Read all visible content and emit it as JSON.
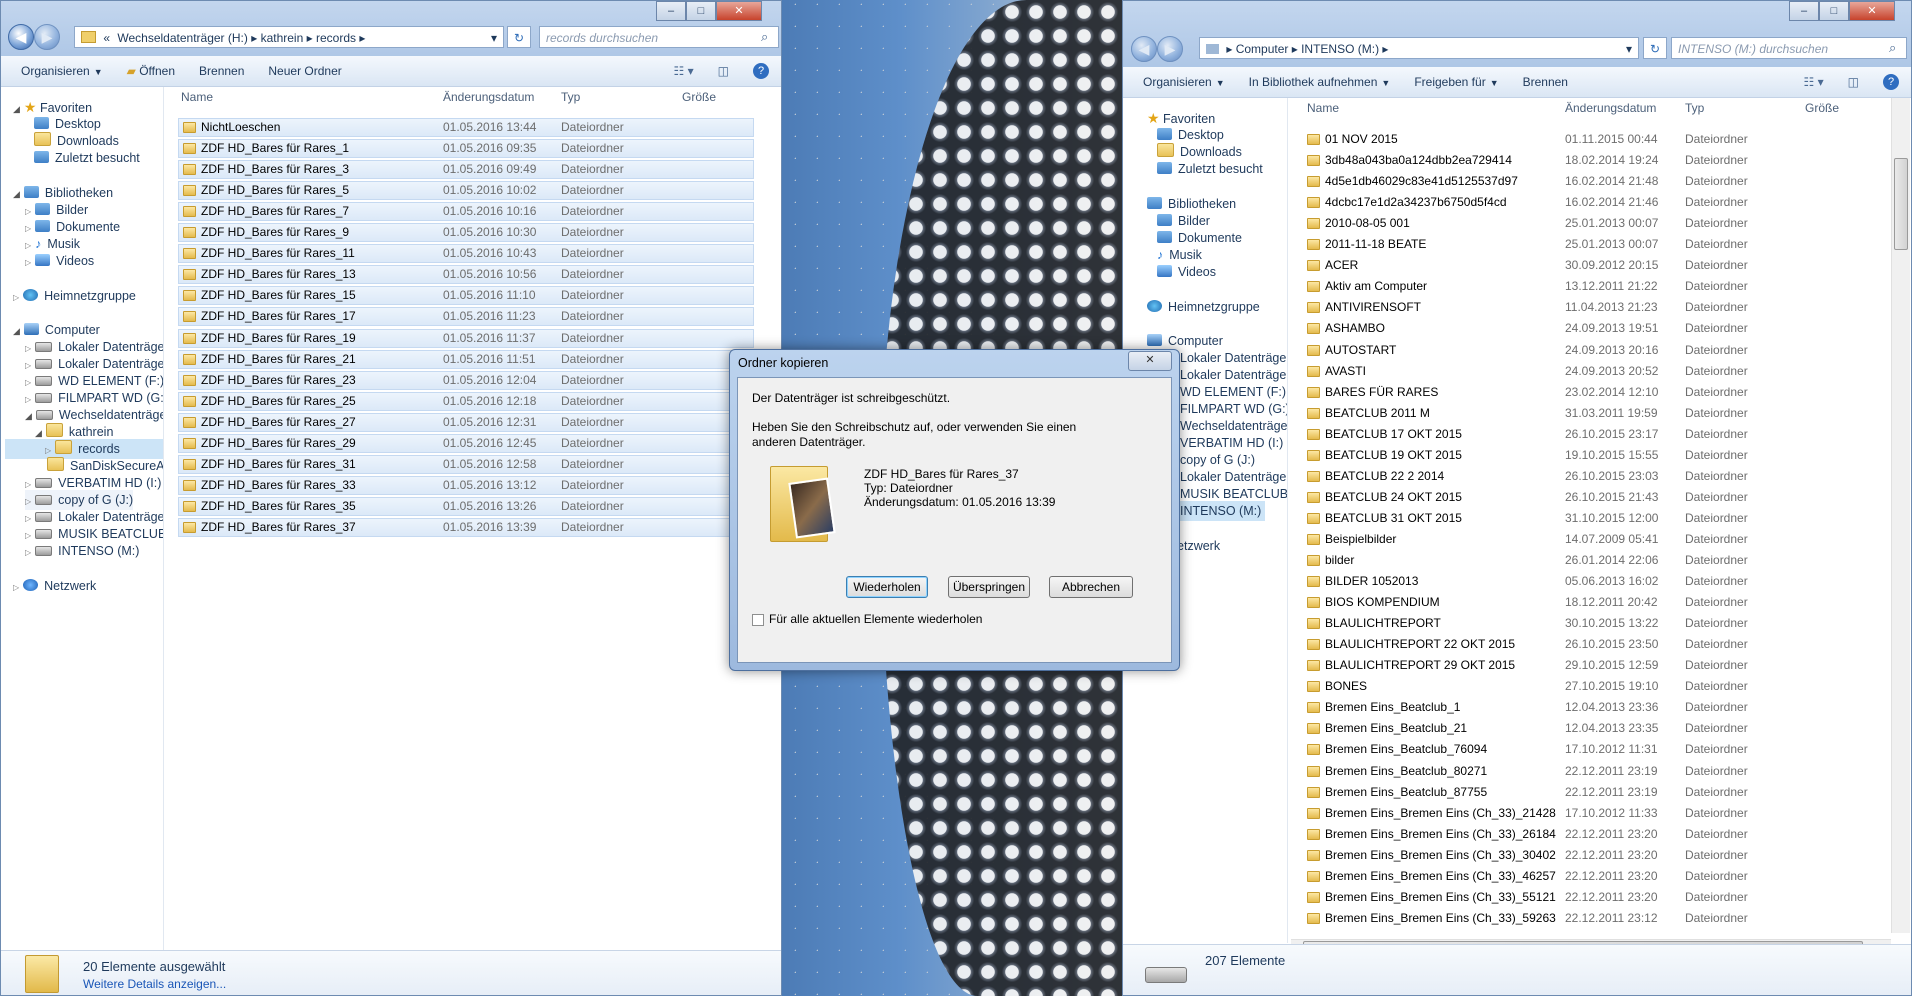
{
  "left_window": {
    "address": {
      "chevron": "«",
      "parts": [
        "Wechseldatenträger (H:)",
        "kathrein",
        "records"
      ]
    },
    "search_placeholder": "records durchsuchen",
    "toolbar": {
      "organize": "Organisieren",
      "open": "Öffnen",
      "burn": "Brennen",
      "new_folder": "Neuer Ordner"
    },
    "columns": {
      "name": "Name",
      "date": "Änderungsdatum",
      "type": "Typ",
      "size": "Größe"
    },
    "nav": {
      "favorites": "Favoriten",
      "desktop": "Desktop",
      "downloads": "Downloads",
      "recent": "Zuletzt besucht",
      "libraries": "Bibliotheken",
      "pictures": "Bilder",
      "documents": "Dokumente",
      "music": "Musik",
      "videos": "Videos",
      "homegroup": "Heimnetzgruppe",
      "computer": "Computer",
      "drives": [
        "Lokaler Datenträger",
        "Lokaler Datenträger",
        "WD ELEMENT (F:)",
        "FILMPART WD (G:)",
        "Wechseldatenträger",
        "kathrein",
        "records",
        "SanDiskSecureAcc",
        "VERBATIM HD (I:)",
        "copy of G (J:)",
        "Lokaler Datenträger",
        "MUSIK BEATCLUB (L",
        "INTENSO (M:)"
      ],
      "network": "Netzwerk"
    },
    "files": [
      {
        "name": "NichtLoeschen",
        "date": "01.05.2016 13:44",
        "type": "Dateiordner"
      },
      {
        "name": "ZDF HD_Bares für Rares_1",
        "date": "01.05.2016 09:35",
        "type": "Dateiordner"
      },
      {
        "name": "ZDF HD_Bares für Rares_3",
        "date": "01.05.2016 09:49",
        "type": "Dateiordner"
      },
      {
        "name": "ZDF HD_Bares für Rares_5",
        "date": "01.05.2016 10:02",
        "type": "Dateiordner"
      },
      {
        "name": "ZDF HD_Bares für Rares_7",
        "date": "01.05.2016 10:16",
        "type": "Dateiordner"
      },
      {
        "name": "ZDF HD_Bares für Rares_9",
        "date": "01.05.2016 10:30",
        "type": "Dateiordner"
      },
      {
        "name": "ZDF HD_Bares für Rares_11",
        "date": "01.05.2016 10:43",
        "type": "Dateiordner"
      },
      {
        "name": "ZDF HD_Bares für Rares_13",
        "date": "01.05.2016 10:56",
        "type": "Dateiordner"
      },
      {
        "name": "ZDF HD_Bares für Rares_15",
        "date": "01.05.2016 11:10",
        "type": "Dateiordner"
      },
      {
        "name": "ZDF HD_Bares für Rares_17",
        "date": "01.05.2016 11:23",
        "type": "Dateiordner"
      },
      {
        "name": "ZDF HD_Bares für Rares_19",
        "date": "01.05.2016 11:37",
        "type": "Dateiordner"
      },
      {
        "name": "ZDF HD_Bares für Rares_21",
        "date": "01.05.2016 11:51",
        "type": "Dateiordner"
      },
      {
        "name": "ZDF HD_Bares für Rares_23",
        "date": "01.05.2016 12:04",
        "type": "Dateiordner"
      },
      {
        "name": "ZDF HD_Bares für Rares_25",
        "date": "01.05.2016 12:18",
        "type": "Dateiordner"
      },
      {
        "name": "ZDF HD_Bares für Rares_27",
        "date": "01.05.2016 12:31",
        "type": "Dateiordner"
      },
      {
        "name": "ZDF HD_Bares für Rares_29",
        "date": "01.05.2016 12:45",
        "type": "Dateiordner"
      },
      {
        "name": "ZDF HD_Bares für Rares_31",
        "date": "01.05.2016 12:58",
        "type": "Dateiordner"
      },
      {
        "name": "ZDF HD_Bares für Rares_33",
        "date": "01.05.2016 13:12",
        "type": "Dateiordner"
      },
      {
        "name": "ZDF HD_Bares für Rares_35",
        "date": "01.05.2016 13:26",
        "type": "Dateiordner"
      },
      {
        "name": "ZDF HD_Bares für Rares_37",
        "date": "01.05.2016 13:39",
        "type": "Dateiordner"
      }
    ],
    "status": {
      "selected": "20 Elemente ausgewählt",
      "details_link": "Weitere Details anzeigen..."
    }
  },
  "right_window": {
    "address": {
      "parts": [
        "Computer",
        "INTENSO (M:)"
      ]
    },
    "search_placeholder": "INTENSO (M:) durchsuchen",
    "toolbar": {
      "organize": "Organisieren",
      "include_library": "In Bibliothek aufnehmen",
      "share": "Freigeben für",
      "burn": "Brennen"
    },
    "columns": {
      "name": "Name",
      "date": "Änderungsdatum",
      "type": "Typ",
      "size": "Größe"
    },
    "nav": {
      "favorites": "Favoriten",
      "desktop": "Desktop",
      "downloads": "Downloads",
      "recent": "Zuletzt besucht",
      "libraries": "Bibliotheken",
      "pictures": "Bilder",
      "documents": "Dokumente",
      "music": "Musik",
      "videos": "Videos",
      "homegroup": "Heimnetzgruppe",
      "computer": "Computer",
      "drives": [
        "Lokaler Datenträger",
        "Lokaler Datenträger",
        "WD ELEMENT (F:)",
        "FILMPART WD (G:)",
        "Wechseldatenträger",
        "VERBATIM HD (I:)",
        "copy of G (J:)",
        "Lokaler Datenträger",
        "MUSIK BEATCLUB (L",
        "INTENSO (M:)"
      ],
      "network": "Netzwerk"
    },
    "files": [
      {
        "name": "01 NOV 2015",
        "date": "01.11.2015 00:44",
        "type": "Dateiordner"
      },
      {
        "name": "3db48a043ba0a124dbb2ea729414",
        "date": "18.02.2014 19:24",
        "type": "Dateiordner"
      },
      {
        "name": "4d5e1db46029c83e41d5125537d97",
        "date": "16.02.2014 21:48",
        "type": "Dateiordner"
      },
      {
        "name": "4dcbc17e1d2a34237b6750d5f4cd",
        "date": "16.02.2014 21:46",
        "type": "Dateiordner"
      },
      {
        "name": "2010-08-05 001",
        "date": "25.01.2013 00:07",
        "type": "Dateiordner"
      },
      {
        "name": "2011-11-18 BEATE",
        "date": "25.01.2013 00:07",
        "type": "Dateiordner"
      },
      {
        "name": "ACER",
        "date": "30.09.2012 20:15",
        "type": "Dateiordner"
      },
      {
        "name": "Aktiv am Computer",
        "date": "13.12.2011 21:22",
        "type": "Dateiordner"
      },
      {
        "name": "ANTIVIRENSOFT",
        "date": "11.04.2013 21:23",
        "type": "Dateiordner"
      },
      {
        "name": "ASHAMBO",
        "date": "24.09.2013 19:51",
        "type": "Dateiordner"
      },
      {
        "name": "AUTOSTART",
        "date": "24.09.2013 20:16",
        "type": "Dateiordner"
      },
      {
        "name": "AVASTI",
        "date": "24.09.2013 20:52",
        "type": "Dateiordner"
      },
      {
        "name": "BARES FÜR RARES",
        "date": "23.02.2014 12:10",
        "type": "Dateiordner"
      },
      {
        "name": "BEATCLUB   2011 M",
        "date": "31.03.2011 19:59",
        "type": "Dateiordner"
      },
      {
        "name": "BEATCLUB 17 OKT 2015",
        "date": "26.10.2015 23:17",
        "type": "Dateiordner"
      },
      {
        "name": "BEATCLUB 19 OKT 2015",
        "date": "19.10.2015 15:55",
        "type": "Dateiordner"
      },
      {
        "name": "BEATCLUB 22 2 2014",
        "date": "26.10.2015 23:03",
        "type": "Dateiordner"
      },
      {
        "name": "BEATCLUB 24 OKT 2015",
        "date": "26.10.2015 21:43",
        "type": "Dateiordner"
      },
      {
        "name": "BEATCLUB 31 OKT 2015",
        "date": "31.10.2015 12:00",
        "type": "Dateiordner"
      },
      {
        "name": "Beispielbilder",
        "date": "14.07.2009 05:41",
        "type": "Dateiordner"
      },
      {
        "name": "bilder",
        "date": "26.01.2014 22:06",
        "type": "Dateiordner"
      },
      {
        "name": "BILDER 1052013",
        "date": "05.06.2013 16:02",
        "type": "Dateiordner"
      },
      {
        "name": "BIOS KOMPENDIUM",
        "date": "18.12.2011 20:42",
        "type": "Dateiordner"
      },
      {
        "name": "BLAULICHTREPORT",
        "date": "30.10.2015 13:22",
        "type": "Dateiordner"
      },
      {
        "name": "BLAULICHTREPORT 22 OKT 2015",
        "date": "26.10.2015 23:50",
        "type": "Dateiordner"
      },
      {
        "name": "BLAULICHTREPORT 29 OKT 2015",
        "date": "29.10.2015 12:59",
        "type": "Dateiordner"
      },
      {
        "name": "BONES",
        "date": "27.10.2015 19:10",
        "type": "Dateiordner"
      },
      {
        "name": "Bremen Eins_Beatclub_1",
        "date": "12.04.2013 23:36",
        "type": "Dateiordner"
      },
      {
        "name": "Bremen Eins_Beatclub_21",
        "date": "12.04.2013 23:35",
        "type": "Dateiordner"
      },
      {
        "name": "Bremen Eins_Beatclub_76094",
        "date": "17.10.2012 11:31",
        "type": "Dateiordner"
      },
      {
        "name": "Bremen Eins_Beatclub_80271",
        "date": "22.12.2011 23:19",
        "type": "Dateiordner"
      },
      {
        "name": "Bremen Eins_Beatclub_87755",
        "date": "22.12.2011 23:19",
        "type": "Dateiordner"
      },
      {
        "name": "Bremen Eins_Bremen Eins (Ch_33)_21428",
        "date": "17.10.2012 11:33",
        "type": "Dateiordner"
      },
      {
        "name": "Bremen Eins_Bremen Eins (Ch_33)_26184",
        "date": "22.12.2011 23:20",
        "type": "Dateiordner"
      },
      {
        "name": "Bremen Eins_Bremen Eins (Ch_33)_30402",
        "date": "22.12.2011 23:20",
        "type": "Dateiordner"
      },
      {
        "name": "Bremen Eins_Bremen Eins (Ch_33)_46257",
        "date": "22.12.2011 23:20",
        "type": "Dateiordner"
      },
      {
        "name": "Bremen Eins_Bremen Eins (Ch_33)_55121",
        "date": "22.12.2011 23:20",
        "type": "Dateiordner"
      },
      {
        "name": "Bremen Eins_Bremen Eins (Ch_33)_59263",
        "date": "22.12.2011 23:12",
        "type": "Dateiordner"
      }
    ],
    "status": {
      "count": "207 Elemente"
    }
  },
  "dialog": {
    "title": "Ordner kopieren",
    "message1": "Der Datenträger ist schreibgeschützt.",
    "message2": "Heben Sie den Schreibschutz auf, oder verwenden Sie einen anderen Datenträger.",
    "item_name": "ZDF HD_Bares für Rares_37",
    "item_type": "Typ: Dateiordner",
    "item_date": "Änderungsdatum: 01.05.2016 13:39",
    "buttons": {
      "retry": "Wiederholen",
      "skip": "Überspringen",
      "cancel": "Abbrechen"
    },
    "checkbox_label": "Für alle aktuellen Elemente wiederholen"
  },
  "colors": {
    "selection": "#cce4f7",
    "accent": "#1e395b",
    "link": "#1a56b7"
  }
}
